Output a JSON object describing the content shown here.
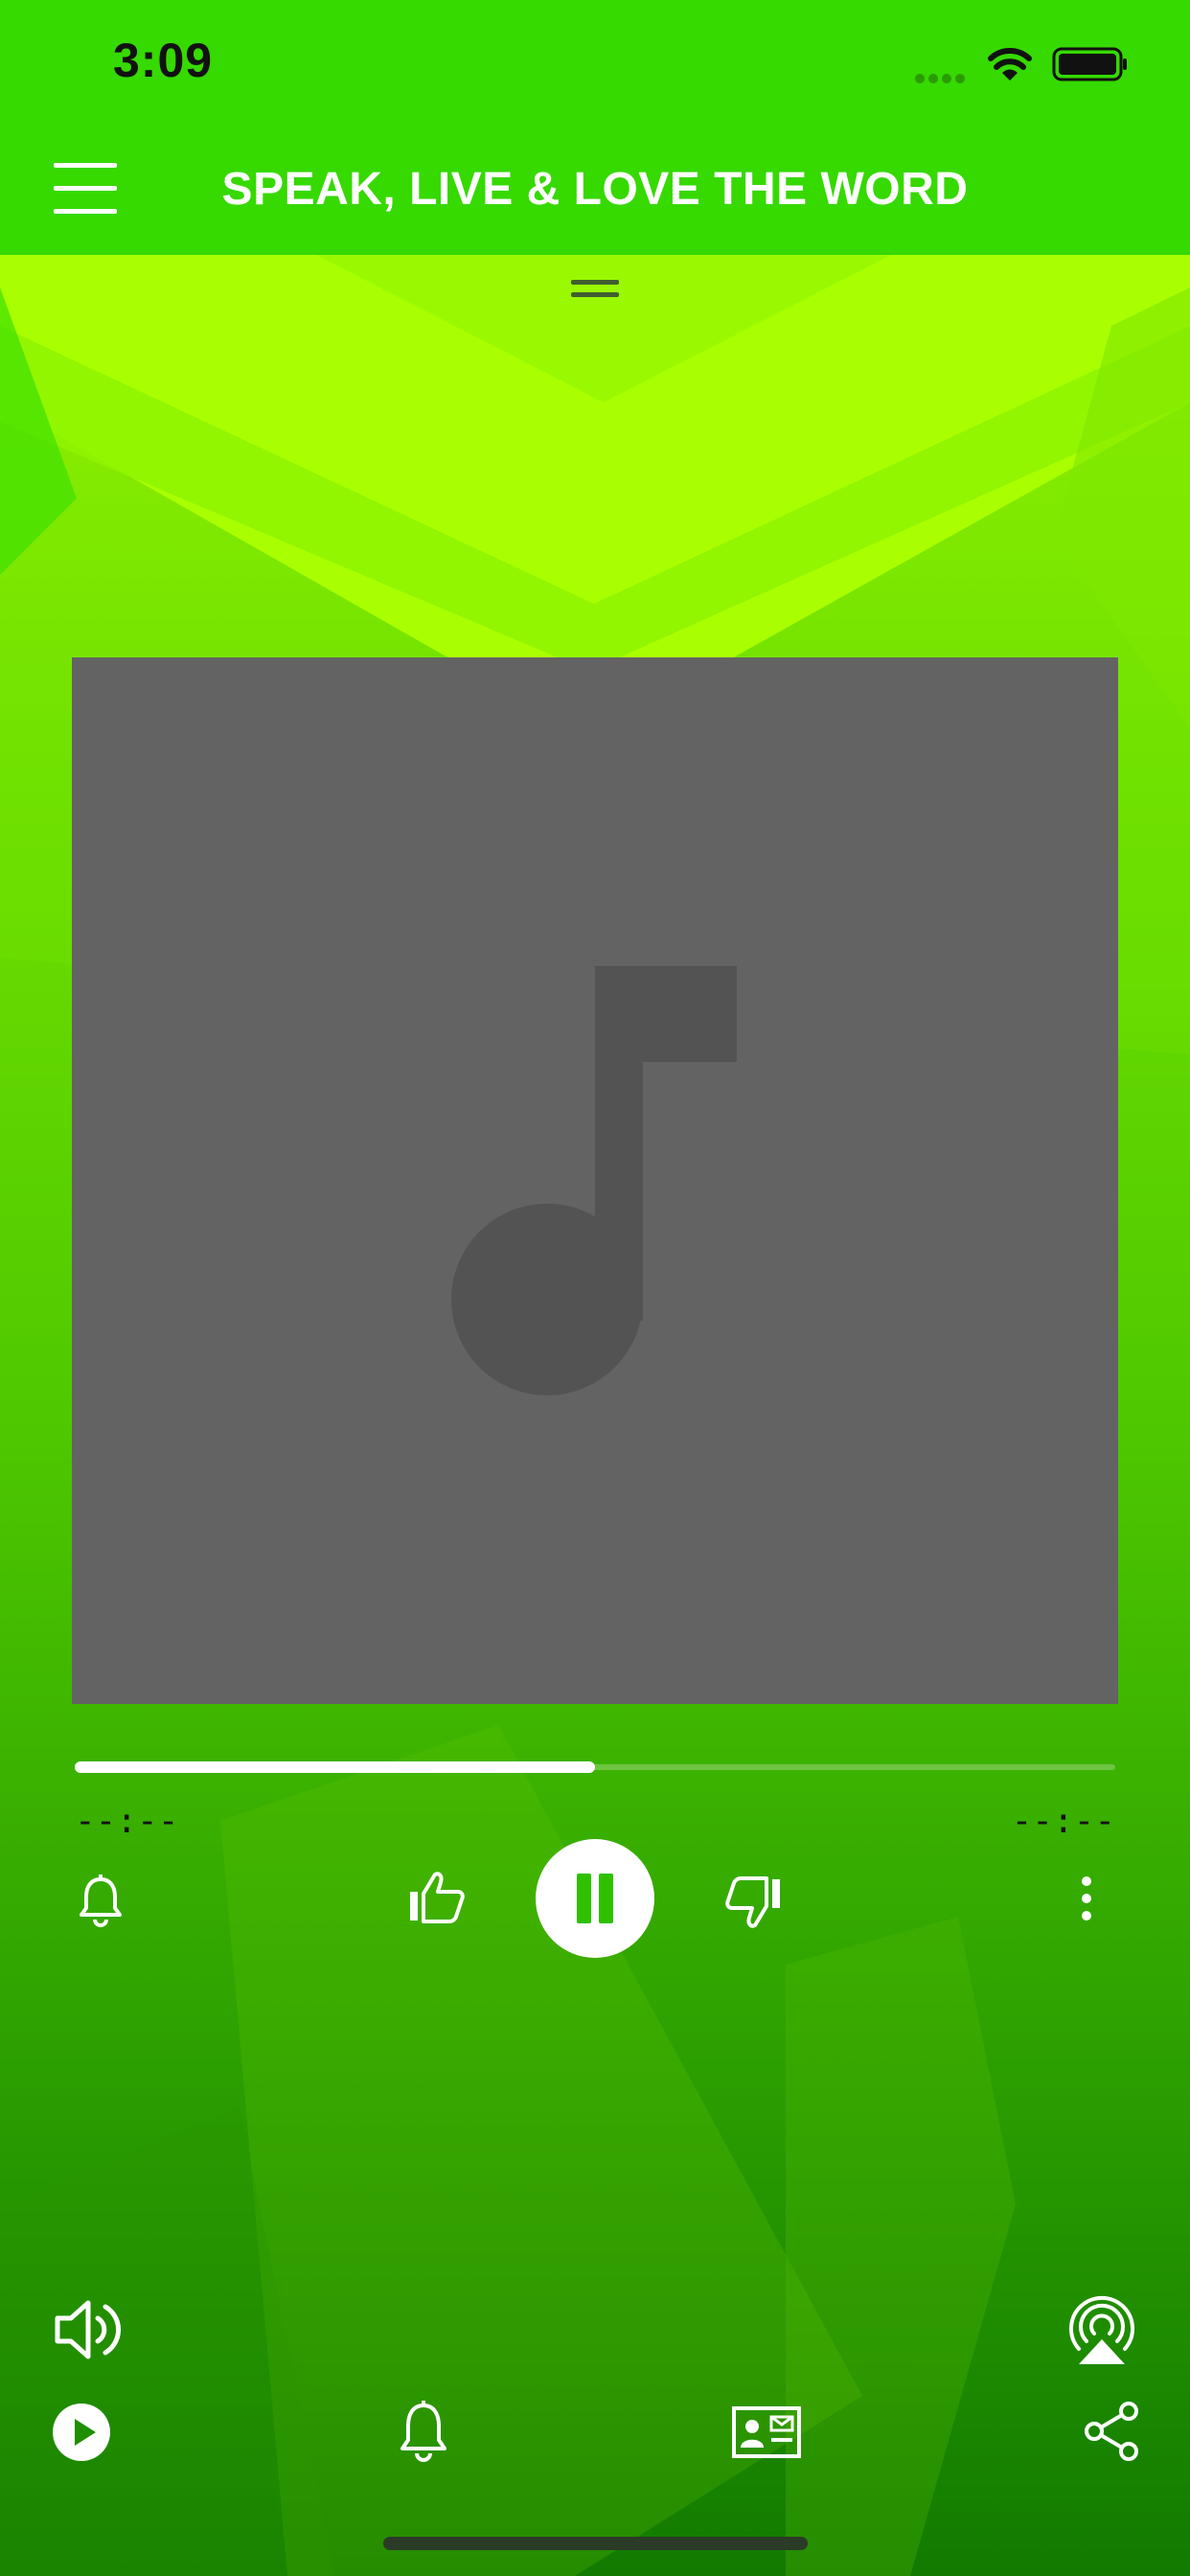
{
  "status_bar": {
    "time": "3:09",
    "icons": [
      "cellular-signal-icon",
      "wifi-icon",
      "battery-icon"
    ]
  },
  "header": {
    "title": "SPEAK, LIVE & LOVE THE WORD",
    "menu_icon": "hamburger-menu-icon",
    "background": "#36d900"
  },
  "player": {
    "artwork_placeholder_icon": "music-note-icon",
    "artwork_background": "#636363",
    "progress_fraction": 0.5,
    "elapsed_time": "--:--",
    "remaining_time": "--:--",
    "controls": {
      "alarm_icon": "bell-icon",
      "like_icon": "thumbs-up-icon",
      "pause_icon": "pause-icon",
      "dislike_icon": "thumbs-down-icon",
      "more_icon": "more-vertical-icon"
    },
    "volume_icon": "speaker-volume-icon",
    "airplay_icon": "airplay-icon"
  },
  "bottom_bar": {
    "items": [
      "play-circle-icon",
      "bell-icon",
      "contact-card-icon",
      "share-icon"
    ]
  },
  "colors": {
    "accent": "#36d900",
    "pause_glyph": "#2fc000",
    "icon": "#ffffff"
  }
}
